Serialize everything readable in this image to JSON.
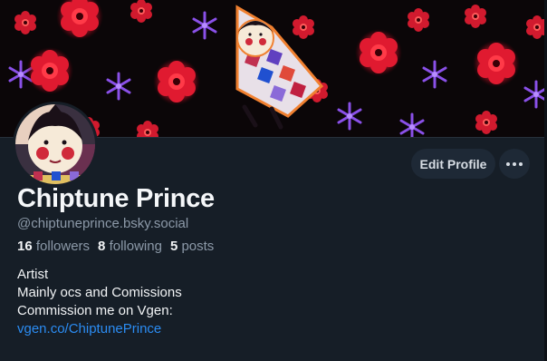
{
  "profile": {
    "display_name": "Chiptune Prince",
    "handle": "@chiptuneprince.bsky.social",
    "followers_count": "16",
    "followers_label": "followers",
    "following_count": "8",
    "following_label": "following",
    "posts_count": "5",
    "posts_label": "posts",
    "bio_lines": [
      "Artist",
      "Mainly ocs and Comissions",
      "Commission me on Vgen:"
    ],
    "bio_link": "vgen.co/ChiptunePrince"
  },
  "actions": {
    "edit_profile_label": "Edit Profile",
    "more_icon": "more-horizontal-icon"
  },
  "colors": {
    "background": "#161e27",
    "accent_link": "#2b8cf2",
    "button_bg": "#1e2936",
    "muted_text": "#8c99a8"
  }
}
